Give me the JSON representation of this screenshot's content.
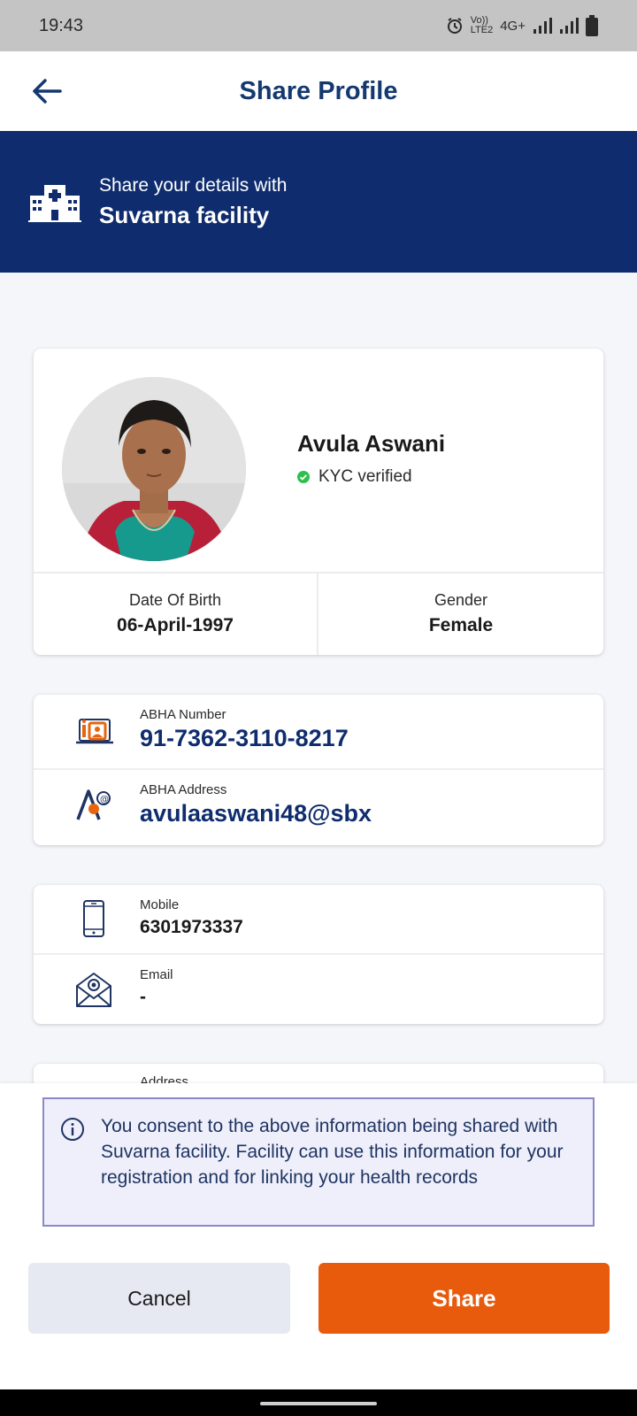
{
  "status_bar": {
    "time": "19:43",
    "network_label": "4G+",
    "volte_label": "Vo))",
    "lte_label": "LTE2"
  },
  "header": {
    "title": "Share Profile"
  },
  "banner": {
    "line1": "Share your details with",
    "line2": "Suvarna facility"
  },
  "profile": {
    "name": "Avula Aswani",
    "kyc_status": "KYC verified",
    "dob_label": "Date Of Birth",
    "dob_value": "06-April-1997",
    "gender_label": "Gender",
    "gender_value": "Female"
  },
  "abha": {
    "number_label": "ABHA Number",
    "number_value": "91-7362-3110-8217",
    "address_label": "ABHA Address",
    "address_value": "avulaaswani48@sbx"
  },
  "contact": {
    "mobile_label": "Mobile",
    "mobile_value": "6301973337",
    "email_label": "Email",
    "email_value": "-"
  },
  "address": {
    "label": "Address"
  },
  "consent": {
    "text": "You consent to the above information being shared with Suvarna facility. Facility can use this information for your registration and for linking your health records"
  },
  "buttons": {
    "cancel": "Cancel",
    "share": "Share"
  },
  "colors": {
    "primary_navy": "#0f2d6e",
    "share_orange": "#e85a0c",
    "kyc_green": "#2fbf4e",
    "icon_orange": "#e8650f"
  }
}
